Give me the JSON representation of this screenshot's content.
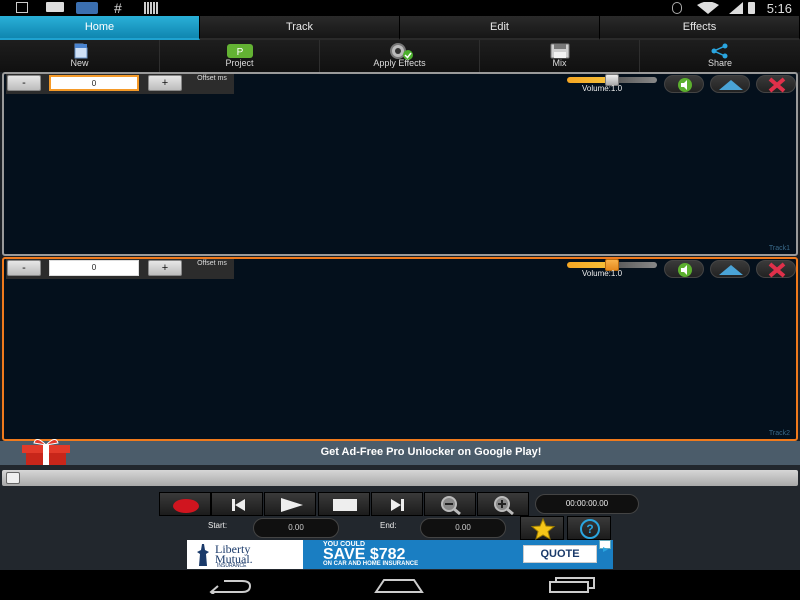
{
  "statusbar": {
    "left_icons": [
      "download-icon",
      "message-icon",
      "app-icon",
      "hash-icon",
      "barcode-icon"
    ],
    "right_icons": [
      "bluetooth-icon",
      "wifi-icon",
      "sim-icon",
      "battery-icon"
    ],
    "time": "5:16"
  },
  "tabs": [
    {
      "label": "Home",
      "active": true
    },
    {
      "label": "Track",
      "active": false
    },
    {
      "label": "Edit",
      "active": false
    },
    {
      "label": "Effects",
      "active": false
    }
  ],
  "toolbar": {
    "items": [
      {
        "label": "New",
        "icon": "new-file-icon"
      },
      {
        "label": "Project",
        "icon": "project-icon"
      },
      {
        "label": "Apply Effects",
        "icon": "apply-effects-icon"
      },
      {
        "label": "Mix",
        "icon": "save-icon"
      },
      {
        "label": "Share",
        "icon": "share-icon"
      }
    ]
  },
  "tracks": [
    {
      "minus": "-",
      "offset_value": "0",
      "plus": "+",
      "offset_label": "Offset ms",
      "volume_label": "Volume:1.0",
      "volume": 1.0,
      "name": "Track1"
    },
    {
      "minus": "-",
      "offset_value": "0",
      "plus": "+",
      "offset_label": "Offset ms",
      "volume_label": "Volume:1.0",
      "volume": 1.0,
      "name": "Track2"
    }
  ],
  "promo": {
    "text": "Get Ad-Free Pro Unlocker on Google Play!",
    "icon": "gift-icon"
  },
  "transport": {
    "time": "00:00:00.00",
    "start_label": "Start:",
    "start_value": "0.00",
    "end_label": "End:",
    "end_value": "0.00",
    "buttons": [
      "record-icon",
      "skip-back-icon",
      "play-icon",
      "stop-icon",
      "skip-forward-icon",
      "zoom-out-icon",
      "zoom-in-icon"
    ]
  },
  "ad": {
    "brand_line1": "Liberty",
    "brand_line2": "Mutual.",
    "brand_line3": "INSURANCE",
    "line1": "YOU COULD",
    "line2": "SAVE $782",
    "line3": "ON CAR AND HOME INSURANCE",
    "cta": "QUOTE"
  },
  "colors": {
    "accent": "#1fa2d0",
    "track2_border": "#f07a1c",
    "promo_bg": "#4b5c6a"
  }
}
